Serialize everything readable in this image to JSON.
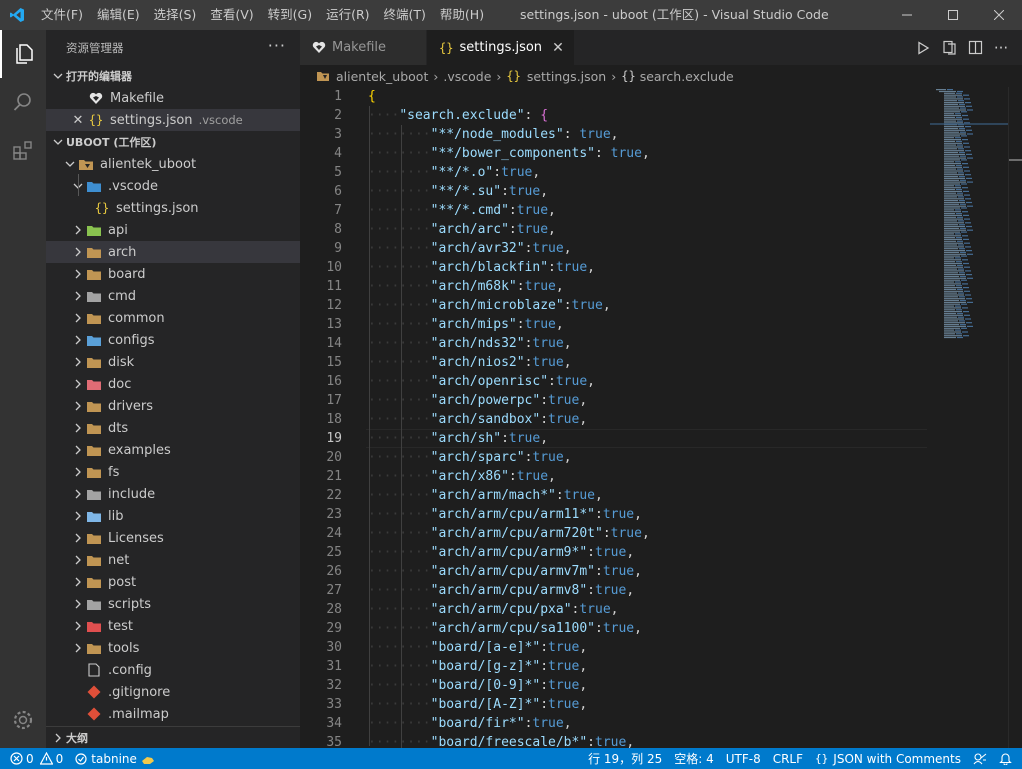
{
  "menu": [
    "文件(F)",
    "编辑(E)",
    "选择(S)",
    "查看(V)",
    "转到(G)",
    "运行(R)",
    "终端(T)",
    "帮助(H)"
  ],
  "window_title": "settings.json - uboot (工作区) - Visual Studio Code",
  "sidebar": {
    "title": "资源管理器",
    "more": "···",
    "open_editors_label": "打开的编辑器",
    "open_editors": [
      {
        "name": "Makefile",
        "desc": ""
      },
      {
        "name": "settings.json",
        "desc": ".vscode"
      }
    ],
    "workspace_label": "UBOOT (工作区)",
    "root": "alientek_uboot",
    "vscode_folder": ".vscode",
    "vscode_file": "settings.json",
    "folders": [
      "api",
      "arch",
      "board",
      "cmd",
      "common",
      "configs",
      "disk",
      "doc",
      "drivers",
      "dts",
      "examples",
      "fs",
      "include",
      "lib",
      "Licenses",
      "net",
      "post",
      "scripts",
      "test",
      "tools"
    ],
    "files": [
      ".config",
      ".gitignore",
      ".mailmap"
    ],
    "outline_label": "大纲"
  },
  "tabs": [
    {
      "label": "Makefile"
    },
    {
      "label": "settings.json"
    }
  ],
  "breadcrumb": [
    "alientek_uboot",
    ".vscode",
    "settings.json",
    "search.exclude"
  ],
  "editor": {
    "current_line": 19,
    "lines": [
      {
        "n": "1",
        "key": "",
        "val": ""
      },
      {
        "n": "2",
        "key": "search.exclude",
        "val": ""
      },
      {
        "n": "3",
        "key": "**/node_modules",
        "val": " true"
      },
      {
        "n": "4",
        "key": "**/bower_components",
        "val": " true"
      },
      {
        "n": "5",
        "key": "**/*.o",
        "val": "true"
      },
      {
        "n": "6",
        "key": "**/*.su",
        "val": "true"
      },
      {
        "n": "7",
        "key": "**/*.cmd",
        "val": "true"
      },
      {
        "n": "8",
        "key": "arch/arc",
        "val": "true"
      },
      {
        "n": "9",
        "key": "arch/avr32",
        "val": "true"
      },
      {
        "n": "10",
        "key": "arch/blackfin",
        "val": "true"
      },
      {
        "n": "11",
        "key": "arch/m68k",
        "val": "true"
      },
      {
        "n": "12",
        "key": "arch/microblaze",
        "val": "true"
      },
      {
        "n": "13",
        "key": "arch/mips",
        "val": "true"
      },
      {
        "n": "14",
        "key": "arch/nds32",
        "val": "true"
      },
      {
        "n": "15",
        "key": "arch/nios2",
        "val": "true"
      },
      {
        "n": "16",
        "key": "arch/openrisc",
        "val": "true"
      },
      {
        "n": "17",
        "key": "arch/powerpc",
        "val": "true"
      },
      {
        "n": "18",
        "key": "arch/sandbox",
        "val": "true"
      },
      {
        "n": "19",
        "key": "arch/sh",
        "val": "true"
      },
      {
        "n": "20",
        "key": "arch/sparc",
        "val": "true"
      },
      {
        "n": "21",
        "key": "arch/x86",
        "val": "true"
      },
      {
        "n": "22",
        "key": "arch/arm/mach*",
        "val": "true"
      },
      {
        "n": "23",
        "key": "arch/arm/cpu/arm11*",
        "val": "true"
      },
      {
        "n": "24",
        "key": "arch/arm/cpu/arm720t",
        "val": "true"
      },
      {
        "n": "25",
        "key": "arch/arm/cpu/arm9*",
        "val": "true"
      },
      {
        "n": "26",
        "key": "arch/arm/cpu/armv7m",
        "val": "true"
      },
      {
        "n": "27",
        "key": "arch/arm/cpu/armv8",
        "val": "true"
      },
      {
        "n": "28",
        "key": "arch/arm/cpu/pxa",
        "val": "true"
      },
      {
        "n": "29",
        "key": "arch/arm/cpu/sa1100",
        "val": "true"
      },
      {
        "n": "30",
        "key": "board/[a-e]*",
        "val": "true"
      },
      {
        "n": "31",
        "key": "board/[g-z]*",
        "val": "true"
      },
      {
        "n": "32",
        "key": "board/[0-9]*",
        "val": "true"
      },
      {
        "n": "33",
        "key": "board/[A-Z]*",
        "val": "true"
      },
      {
        "n": "34",
        "key": "board/fir*",
        "val": "true"
      },
      {
        "n": "35",
        "key": "board/freescale/b*",
        "val": "true"
      }
    ]
  },
  "statusbar": {
    "errors": "0",
    "warnings": "0",
    "tabnine": "tabnine",
    "position": "行 19，列 25",
    "spaces": "空格: 4",
    "encoding": "UTF-8",
    "eol": "CRLF",
    "language": "JSON with Comments"
  },
  "colors": {
    "accent": "#007acc",
    "key": "#9cdcfe",
    "string": "#ce9178",
    "bool": "#569cd6"
  }
}
